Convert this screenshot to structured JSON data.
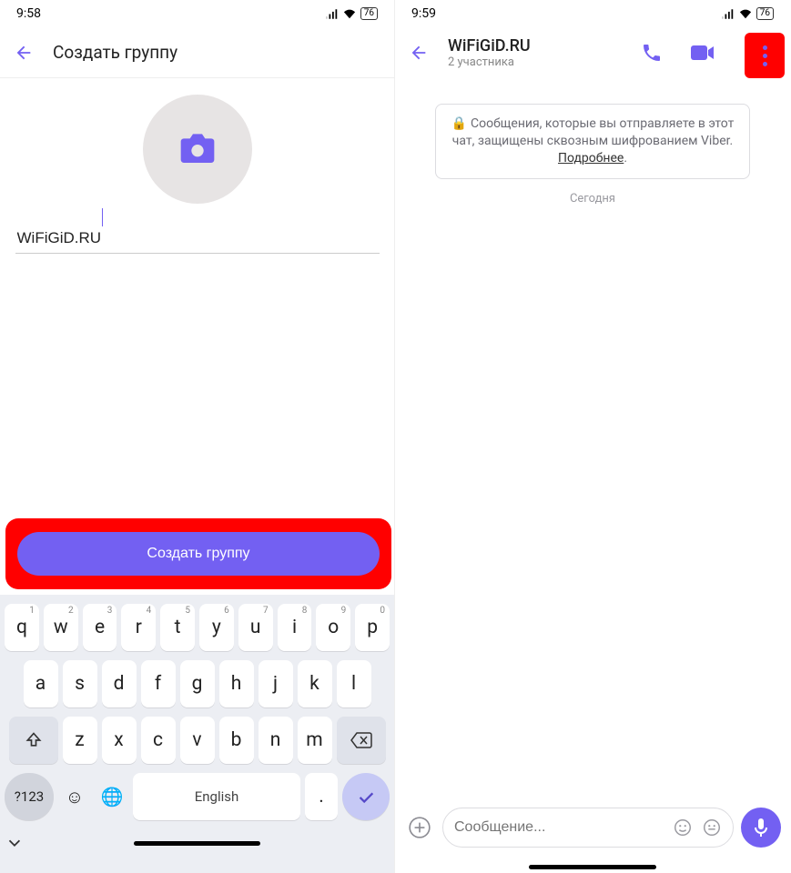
{
  "left": {
    "time": "9:58",
    "battery": "76",
    "header_title": "Создать группу",
    "group_name": "WiFiGiD.RU",
    "create_button": "Создать группу",
    "keyboard": {
      "row1": [
        "q",
        "w",
        "e",
        "r",
        "t",
        "y",
        "u",
        "i",
        "o",
        "p"
      ],
      "row1sup": [
        "1",
        "2",
        "3",
        "4",
        "5",
        "6",
        "7",
        "8",
        "9",
        "0"
      ],
      "row2": [
        "a",
        "s",
        "d",
        "f",
        "g",
        "h",
        "j",
        "k",
        "l"
      ],
      "row3": [
        "z",
        "x",
        "c",
        "v",
        "b",
        "n",
        "m"
      ],
      "sym": "?123",
      "space": "English",
      "dot": "."
    }
  },
  "right": {
    "time": "9:59",
    "battery": "76",
    "chat_title": "WiFiGiD.RU",
    "chat_subtitle": "2 участника",
    "encryption_text": "Сообщения, которые вы отправляете в этот чат, защищены сквозным шифрованием Viber. ",
    "encryption_link": "Подробнее",
    "today": "Сегодня",
    "composer_placeholder": "Сообщение..."
  }
}
